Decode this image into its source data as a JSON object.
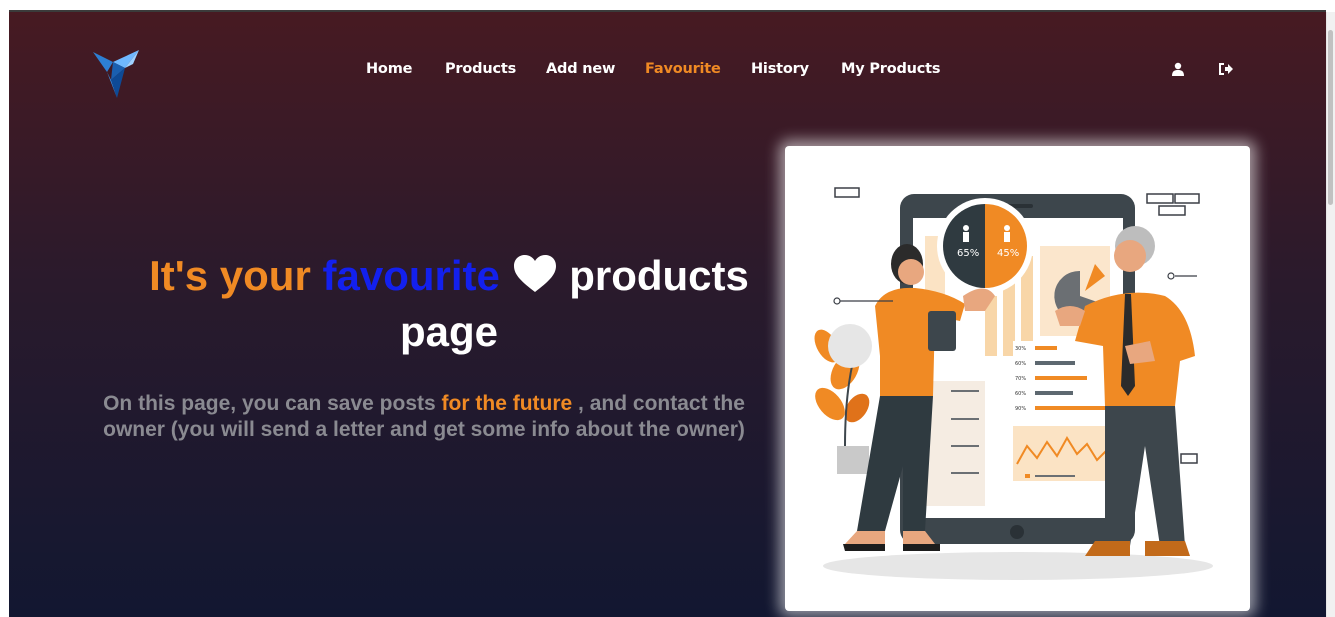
{
  "nav": {
    "items": [
      {
        "label": "Home",
        "active": false
      },
      {
        "label": "Products",
        "active": false
      },
      {
        "label": "Add new",
        "active": false
      },
      {
        "label": "Favourite",
        "active": true
      },
      {
        "label": "History",
        "active": false
      },
      {
        "label": "My Products",
        "active": false
      }
    ],
    "profile_icon": "user-icon",
    "logout_icon": "sign-out-icon"
  },
  "hero": {
    "title_part1": "It's your",
    "title_part2": "favourite",
    "title_part3": "products",
    "title_part4": "page",
    "text_part1": "On this page, you can save posts",
    "text_highlight": "for the future",
    "text_part2": ", and contact the owner (you will send a letter and get some info about the owner)"
  },
  "illustration": {
    "chart_left_pct": "65%",
    "chart_right_pct": "45%",
    "bar_labels": [
      "30%",
      "60%",
      "70%",
      "60%",
      "90%"
    ]
  },
  "colors": {
    "accent_orange": "#f08a24",
    "accent_blue": "#1320ee",
    "bg_top": "#471a22",
    "bg_bottom": "#121731",
    "muted_text": "#8a8a91"
  }
}
